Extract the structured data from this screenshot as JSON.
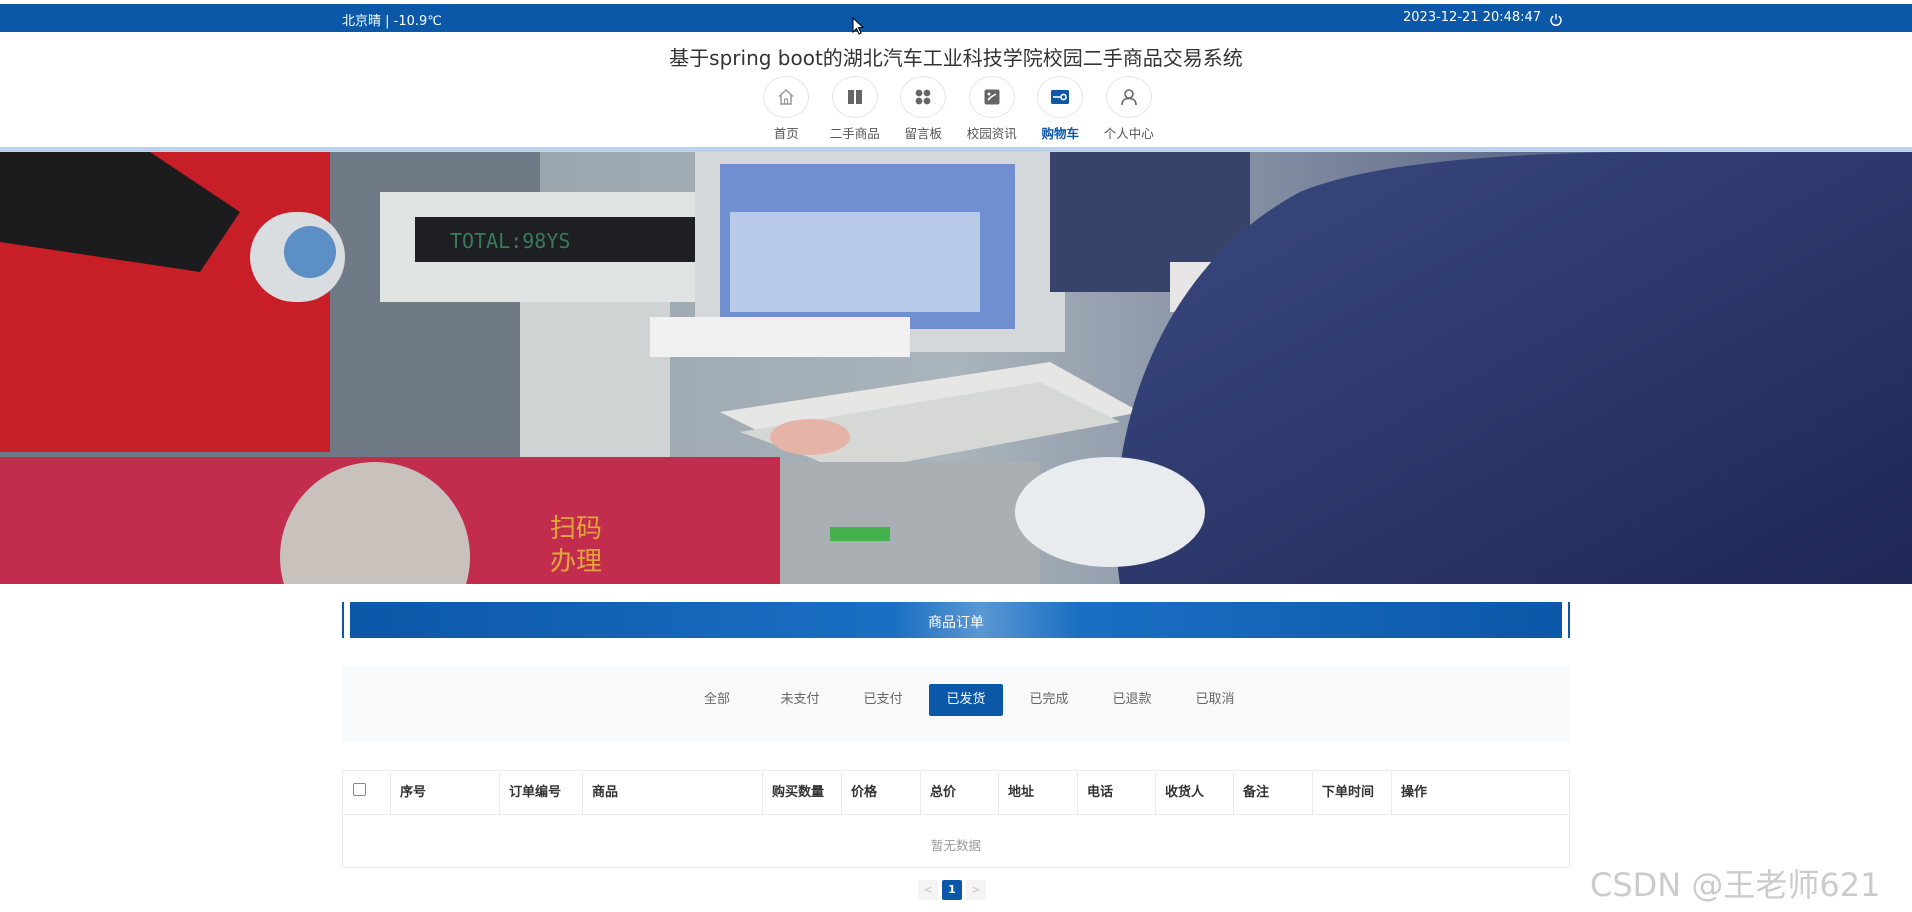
{
  "topbar": {
    "weather": "北京晴 | -10.9℃",
    "datetime": "2023-12-21  20:48:47",
    "power_icon": "power-icon"
  },
  "site": {
    "title": "基于spring boot的湖北汽车工业科技学院校园二手商品交易系统"
  },
  "nav": {
    "items": [
      {
        "label": "首页",
        "icon": "home-icon"
      },
      {
        "label": "二手商品",
        "icon": "book-icon"
      },
      {
        "label": "留言板",
        "icon": "grid-dots-icon"
      },
      {
        "label": "校园资讯",
        "icon": "image-icon"
      },
      {
        "label": "购物车",
        "icon": "cart-icon"
      },
      {
        "label": "个人中心",
        "icon": "user-icon"
      }
    ],
    "active_index": 4
  },
  "section": {
    "title": "商品订单"
  },
  "tabs": {
    "items": [
      "全部",
      "未支付",
      "已支付",
      "已发货",
      "已完成",
      "已退款",
      "已取消"
    ],
    "active_index": 3
  },
  "table": {
    "headers": [
      "序号",
      "订单编号",
      "商品",
      "购买数量",
      "价格",
      "总价",
      "地址",
      "电话",
      "收货人",
      "备注",
      "下单时间",
      "操作"
    ],
    "empty_text": "暂无数据"
  },
  "pagination": {
    "prev": "<",
    "current": "1",
    "next": ">"
  },
  "watermark": "CSDN @王老师621",
  "colors": {
    "primary": "#0b57a8",
    "nav_line": "#b9d3ec",
    "panel_bg": "#f7f9fb"
  }
}
